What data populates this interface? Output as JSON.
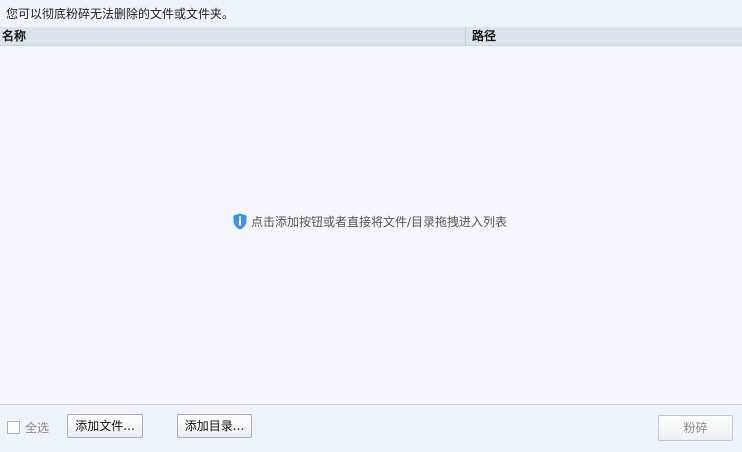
{
  "description": "您可以彻底粉碎无法删除的文件或文件夹。",
  "list": {
    "columns": {
      "name": "名称",
      "path": "路径"
    },
    "empty_hint": "点击添加按钮或者直接将文件/目录拖拽进入列表"
  },
  "footer": {
    "select_all_label": "全选",
    "select_all_checked": false,
    "add_file_label": "添加文件...",
    "add_dir_label": "添加目录...",
    "shred_label": "粉碎"
  },
  "icons": {
    "hint_icon": "info-shield-icon"
  },
  "colors": {
    "background": "#eef4fa",
    "header_bg": "#dde3ea",
    "info_icon": "#4a90d9"
  }
}
